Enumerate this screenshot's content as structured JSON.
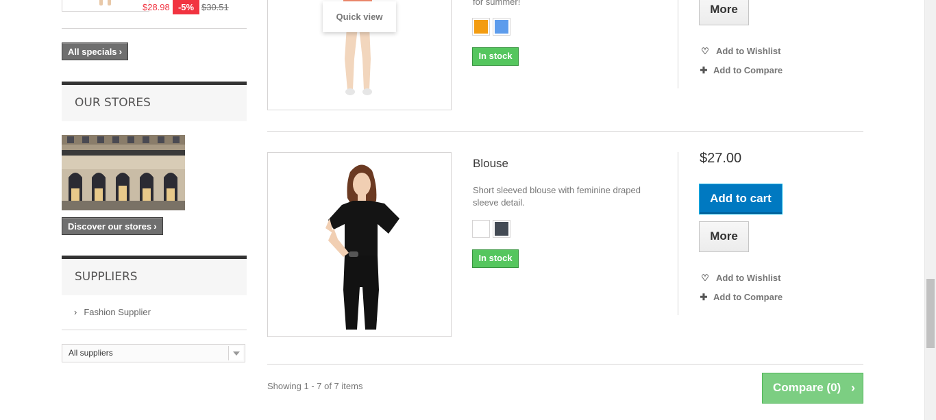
{
  "specials": {
    "price": "$28.98",
    "reduction": "-5%",
    "old_price": "$30.51",
    "all_specials_label": "All specials"
  },
  "stores": {
    "title": "OUR STORES",
    "discover_label": "Discover our stores"
  },
  "suppliers": {
    "title": "SUPPLIERS",
    "items": [
      "Fashion Supplier"
    ],
    "select_value": "All suppliers"
  },
  "products": [
    {
      "name": "",
      "description": "for summer!",
      "quick_view_label": "Quick view",
      "colors": [
        "#f39c11",
        "#5d9cec"
      ],
      "availability": "In stock",
      "more_label": "More",
      "wishlist_label": "Add to Wishlist",
      "compare_label": "Add to Compare"
    },
    {
      "name": "Blouse",
      "description": "Short sleeved blouse with feminine draped sleeve detail.",
      "price": "$27.00",
      "add_to_cart_label": "Add to cart",
      "more_label": "More",
      "colors": [
        "#ffffff",
        "#434a54"
      ],
      "availability": "In stock",
      "wishlist_label": "Add to Wishlist",
      "compare_label": "Add to Compare"
    }
  ],
  "footer": {
    "showing": "Showing 1 - 7 of 7 items",
    "compare_label": "Compare (0)"
  },
  "colors": {
    "accent_blue": "#0079c1",
    "in_stock_green": "#55c65e",
    "sale_red": "#f13340",
    "compare_green": "#7cce82"
  }
}
